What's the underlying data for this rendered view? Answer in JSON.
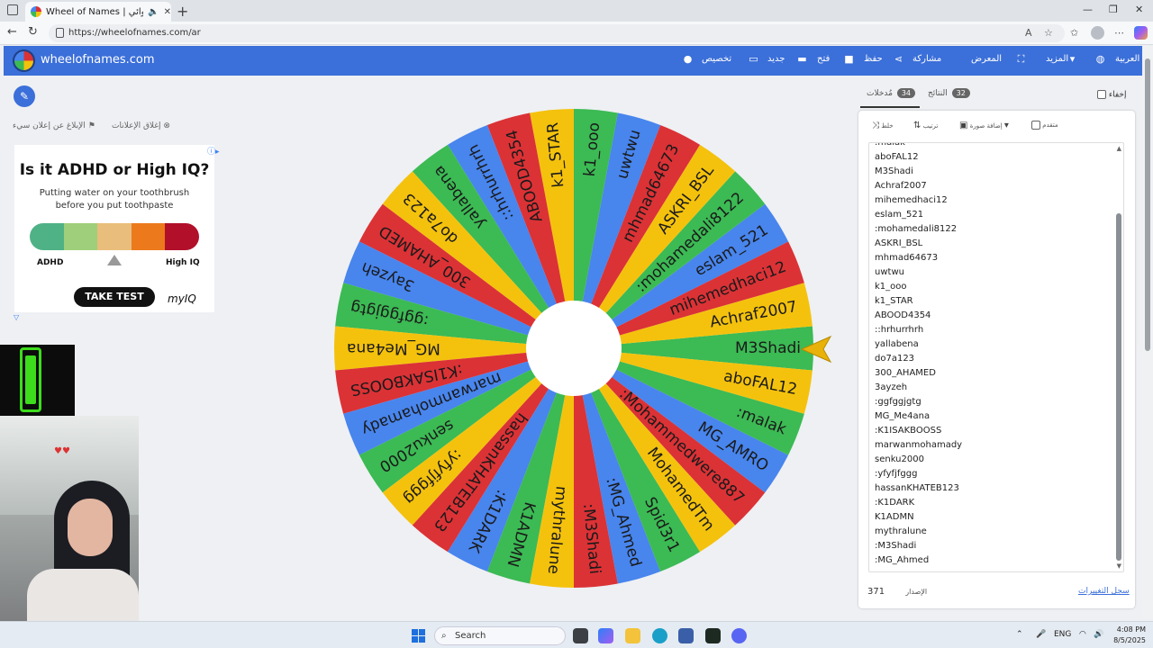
{
  "browser": {
    "tab_title": "Wheel of Names | العشوائي ...",
    "url": "https://wheelofnames.com/ar"
  },
  "header": {
    "brand": "wheelofnames.com",
    "nav": [
      "تخصيص",
      "جديد",
      "فتح",
      "حفظ",
      "مشاركة",
      "المعرض",
      "المزيد",
      "العربية"
    ]
  },
  "left": {
    "report_ad": "الإبلاغ عن إعلان سيء",
    "close_ads": "إغلاق الإعلانات"
  },
  "ad": {
    "title": "Is it ADHD or High IQ?",
    "subtitle_line1": "Putting water on your toothbrush",
    "subtitle_line2": "before you put toothpaste",
    "label_left": "ADHD",
    "label_right": "High IQ",
    "cta": "TAKE TEST",
    "brand": "myIQ",
    "bar_colors": [
      "#4fb286",
      "#9fcf7a",
      "#e9bd7b",
      "#ec7a1d",
      "#b2102a"
    ]
  },
  "wheel": {
    "colors": [
      "#3cba54",
      "#f4c20d",
      "#db3236",
      "#4885ed"
    ],
    "text_color": "#1a1a1a",
    "rotation_deg": 0,
    "segments": [
      "M3Shadi",
      "Achraf2007",
      "mihemedhaci12",
      "eslam_521",
      ":mohamedali8122",
      "ASKRI_BSL",
      "mhmad64673",
      "uwtwu",
      "k1_ooo",
      "k1_STAR",
      "ABOOD4354",
      "::hrhurrhrh",
      "yallabena",
      "do7a123",
      "300_AHAMED",
      "3ayzeh",
      ":ggfggjgtg",
      "MG_Me4ana",
      ":K1ISAKBOOSS",
      "marwanmohamady",
      "senku2000",
      ":yfyfjfggg",
      "hassanKHATEB123",
      ":K1DARK",
      "K1ADMN",
      "mythralune",
      ":M3Shadi",
      ":MG_Ahmed",
      "Spid3r1",
      "MohamedTm",
      ":Mohammedwere887",
      "MG_AMRO",
      ":malak",
      "aboFAL12"
    ]
  },
  "panel": {
    "hide_label": "إخفاء",
    "tab_entries": "مُدخلات",
    "entries_count": "34",
    "tab_results": "النتائج",
    "results_count": "32",
    "tools": [
      "خلط",
      "ترتيب",
      "إضافة صورة",
      "متقدم"
    ],
    "names": [
      ":malak",
      "aboFAL12",
      "M3Shadi",
      "Achraf2007",
      "mihemedhaci12",
      "eslam_521",
      ":mohamedali8122",
      "ASKRI_BSL",
      "mhmad64673",
      "uwtwu",
      "k1_ooo",
      "k1_STAR",
      "ABOOD4354",
      "::hrhurrhrh",
      "yallabena",
      "do7a123",
      "300_AHAMED",
      "3ayzeh",
      ":ggfggjgtg",
      "MG_Me4ana",
      ":K1ISAKBOOSS",
      "marwanmohamady",
      "senku2000",
      ":yfyfjfggg",
      "hassanKHATEB123",
      ":K1DARK",
      "K1ADMN",
      "mythralune",
      ":M3Shadi",
      ":MG_Ahmed"
    ],
    "version_num": "371",
    "version_label": "الإصدار",
    "changelog": "سجل التغييرات"
  },
  "taskbar": {
    "search": "Search",
    "lang": "ENG",
    "time": "4:08 PM",
    "date": "8/5/2025"
  }
}
